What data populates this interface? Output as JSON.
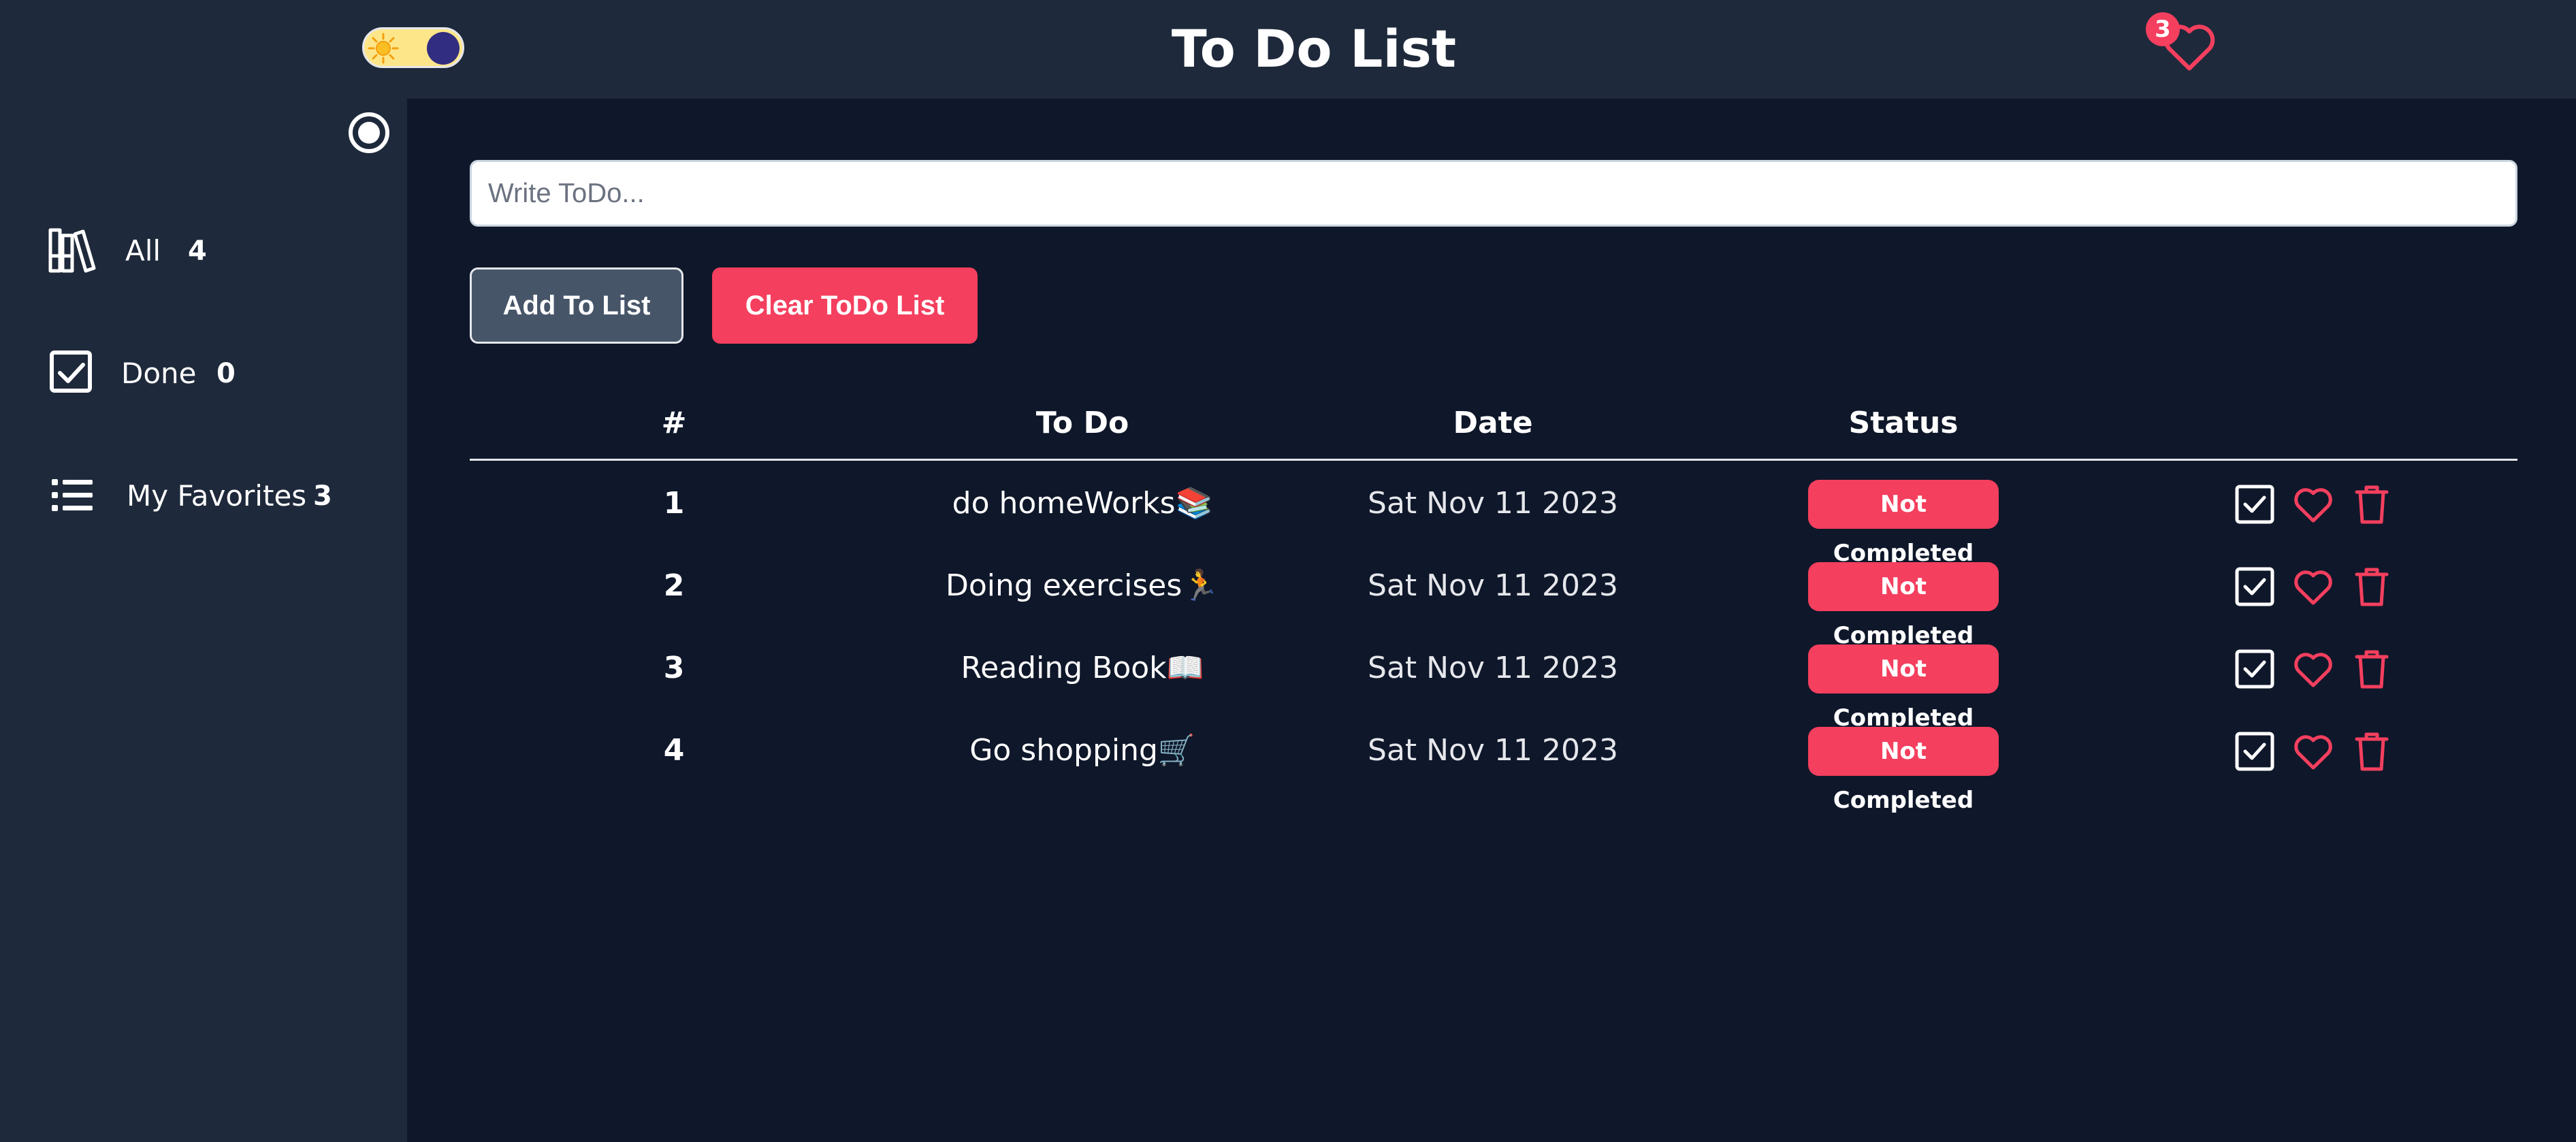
{
  "header": {
    "title": "To Do List",
    "favorites_count": "3",
    "theme_toggle_state": "dark"
  },
  "sidebar": {
    "items": [
      {
        "label": "All",
        "count": "4",
        "icon": "books-icon"
      },
      {
        "label": "Done",
        "count": "0",
        "icon": "checkbox-icon"
      },
      {
        "label": "My Favorites",
        "count": "3",
        "icon": "list-icon"
      }
    ]
  },
  "form": {
    "placeholder": "Write ToDo...",
    "value": "",
    "add_label": "Add To List",
    "clear_label": "Clear ToDo List"
  },
  "table": {
    "headers": [
      "#",
      "To Do",
      "Date",
      "Status"
    ],
    "rows": [
      {
        "num": "1",
        "todo": "do homeWorks📚",
        "date": "Sat Nov 11 2023",
        "status": "Not Completed"
      },
      {
        "num": "2",
        "todo": "Doing exercises🏃",
        "date": "Sat Nov 11 2023",
        "status": "Not Completed"
      },
      {
        "num": "3",
        "todo": "Reading Book📖",
        "date": "Sat Nov 11 2023",
        "status": "Not Completed"
      },
      {
        "num": "4",
        "todo": "Go shopping🛒",
        "date": "Sat Nov 11 2023",
        "status": "Not Completed"
      }
    ]
  },
  "colors": {
    "background": "#0f172a",
    "panel": "#1e293b",
    "accent": "#f43f5e",
    "secondary_button": "#475569"
  }
}
